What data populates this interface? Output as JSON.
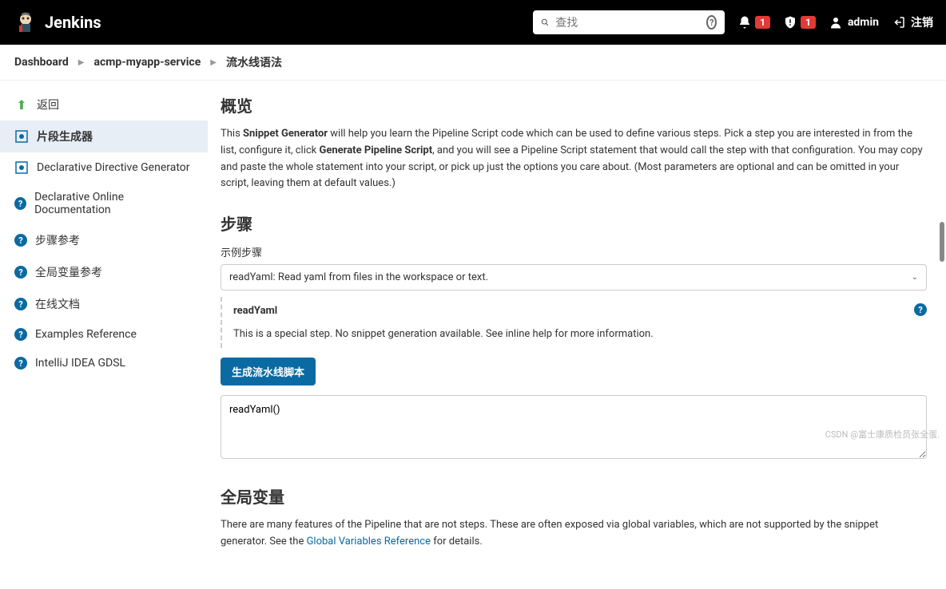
{
  "header": {
    "brand": "Jenkins",
    "search_placeholder": "查找",
    "notif_count": "1",
    "alert_count": "1",
    "username": "admin",
    "logout_label": "注销"
  },
  "breadcrumb": {
    "items": [
      "Dashboard",
      "acmp-myapp-service",
      "流水线语法"
    ]
  },
  "sidebar": {
    "items": [
      {
        "label": "返回",
        "icon": "arrow-up"
      },
      {
        "label": "片段生成器",
        "icon": "generator",
        "active": true
      },
      {
        "label": "Declarative Directive Generator",
        "icon": "generator"
      },
      {
        "label": "Declarative Online Documentation",
        "icon": "help"
      },
      {
        "label": "步骤参考",
        "icon": "help"
      },
      {
        "label": "全局变量参考",
        "icon": "help"
      },
      {
        "label": "在线文档",
        "icon": "help"
      },
      {
        "label": "Examples Reference",
        "icon": "help"
      },
      {
        "label": "IntelliJ IDEA GDSL",
        "icon": "help"
      }
    ]
  },
  "content": {
    "overview_title": "概览",
    "overview_text_1": "This ",
    "overview_bold_1": "Snippet Generator",
    "overview_text_2": " will help you learn the Pipeline Script code which can be used to define various steps. Pick a step you are interested in from the list, configure it, click ",
    "overview_bold_2": "Generate Pipeline Script",
    "overview_text_3": ", and you will see a Pipeline Script statement that would call the step with that configuration. You may copy and paste the whole statement into your script, or pick up just the options you care about. (Most parameters are optional and can be omitted in your script, leaving them at default values.)",
    "steps_title": "步骤",
    "example_step_label": "示例步骤",
    "selected_step": "readYaml: Read yaml from files in the workspace or text.",
    "step_name": "readYaml",
    "step_desc": "This is a special step. No snippet generation available. See inline help for more information.",
    "generate_btn": "生成流水线脚本",
    "output_value": "readYaml()",
    "globals_title": "全局变量",
    "globals_text_1": "There are many features of the Pipeline that are not steps. These are often exposed via global variables, which are not supported by the snippet generator. See the ",
    "globals_link": "Global Variables Reference",
    "globals_text_2": " for details."
  },
  "watermark": "CSDN @富士康质检员张全蛋."
}
